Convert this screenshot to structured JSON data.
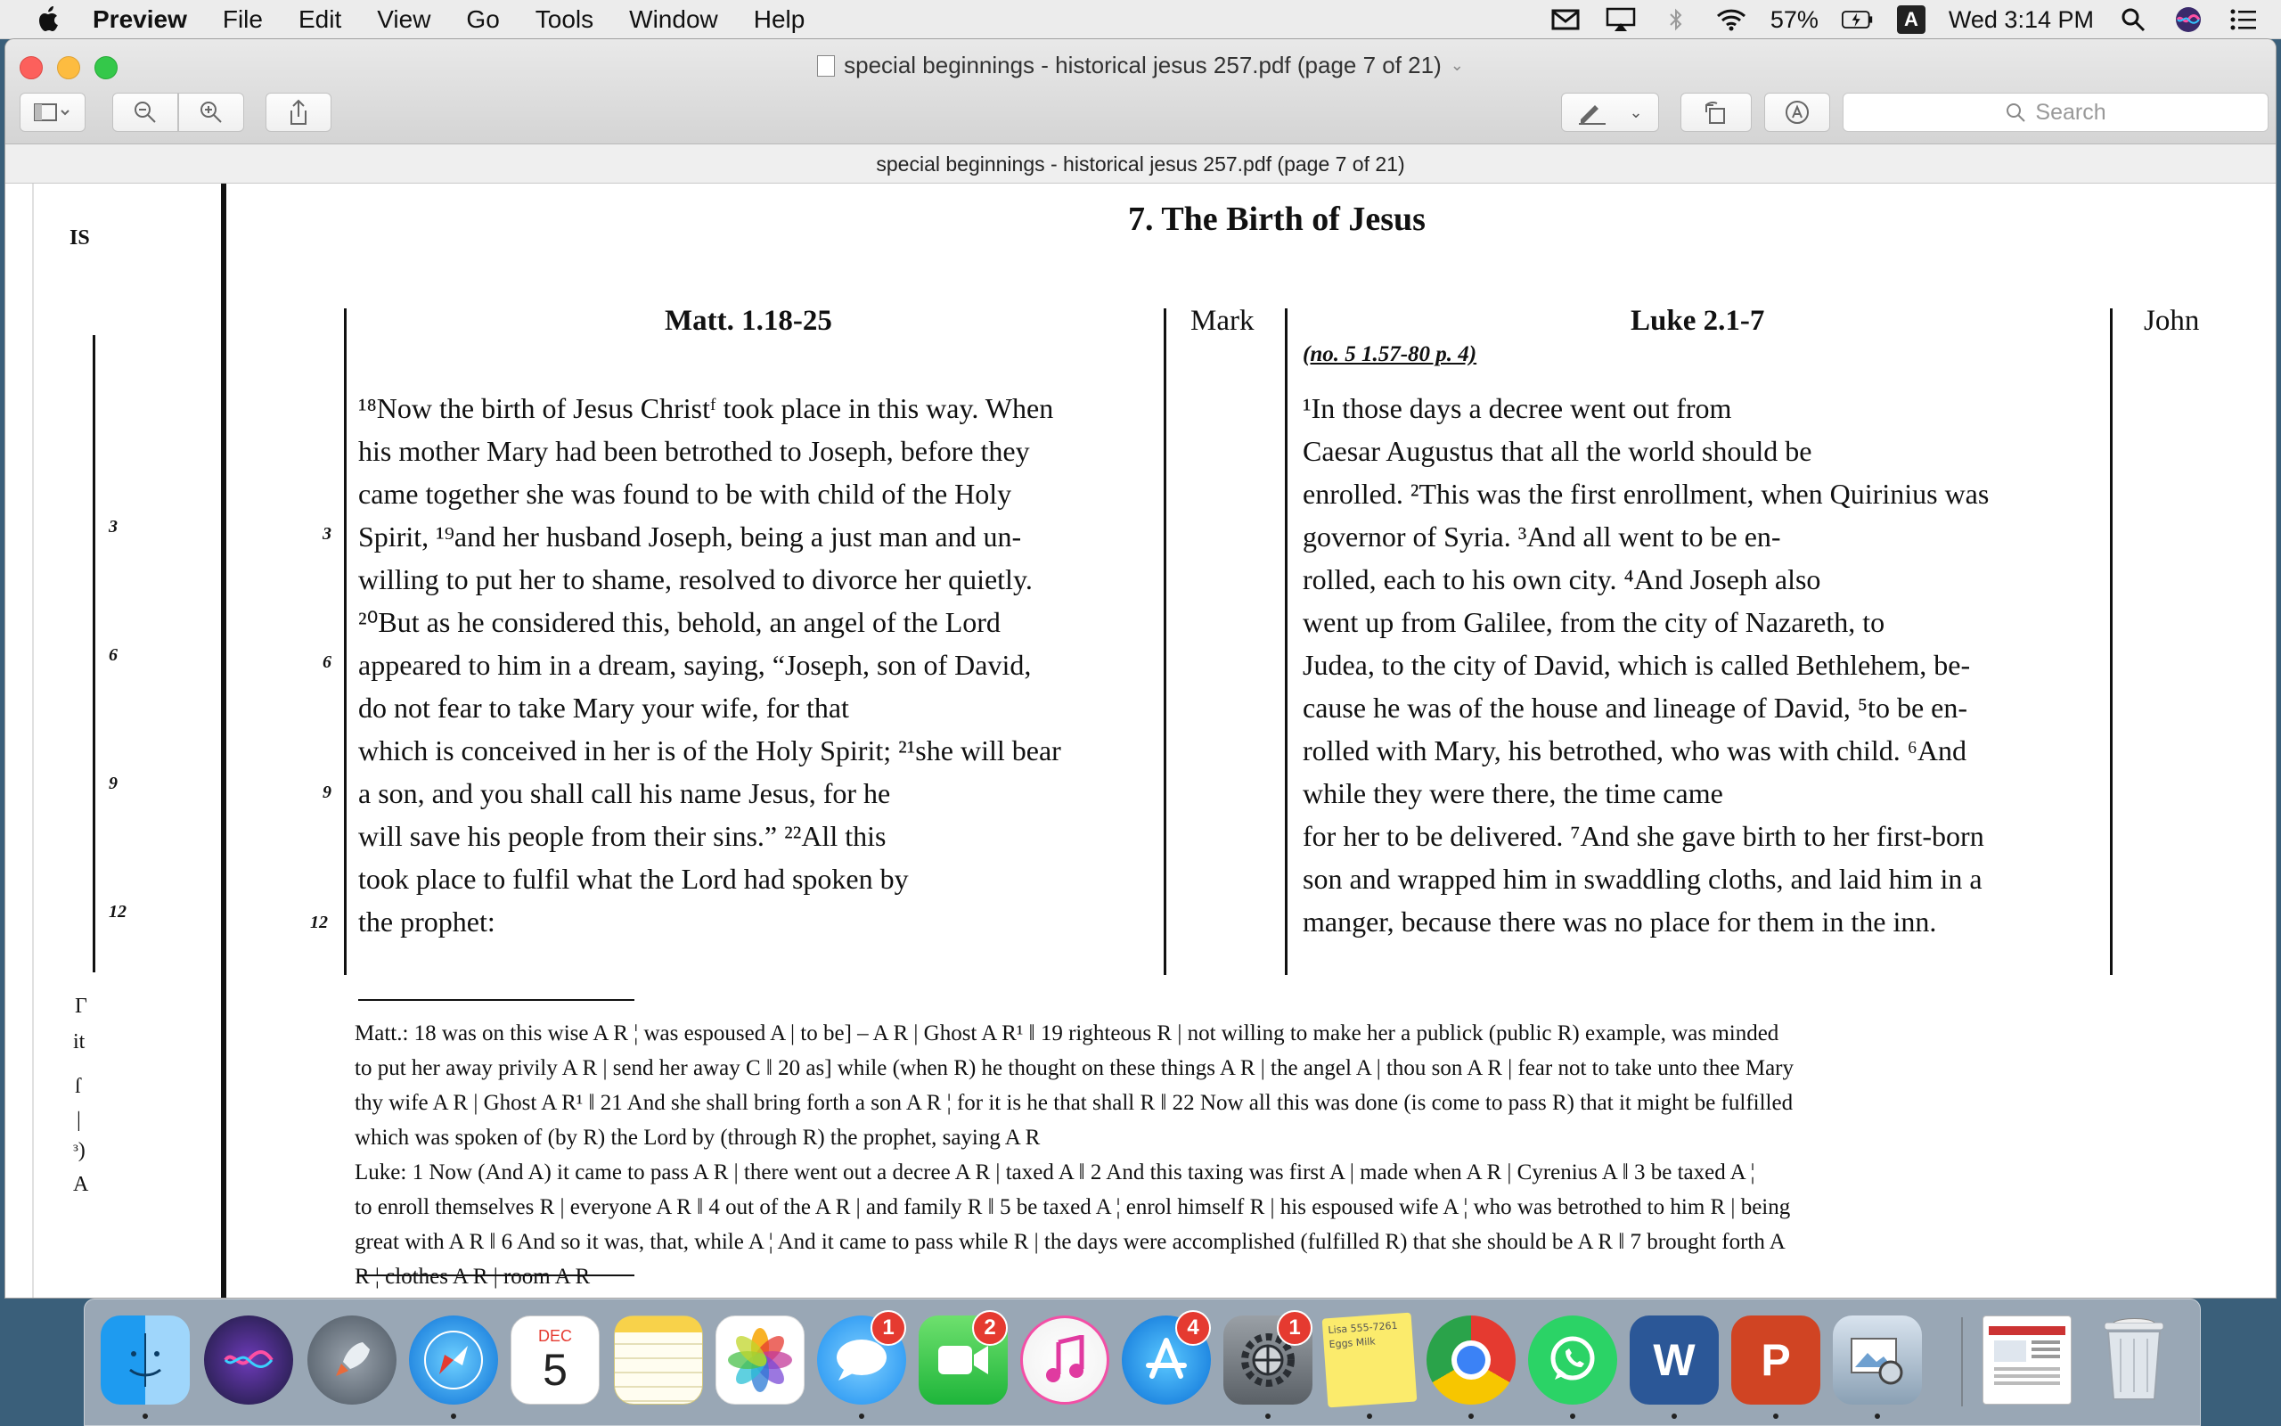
{
  "menubar": {
    "app": "Preview",
    "items": [
      "File",
      "Edit",
      "View",
      "Go",
      "Tools",
      "Window",
      "Help"
    ],
    "battery": "57%",
    "input_source": "A",
    "clock": "Wed 3:14 PM"
  },
  "window": {
    "title": "special beginnings - historical jesus 257.pdf (page 7 of 21)",
    "subtitle": "special beginnings - historical jesus 257.pdf (page 7 of 21)",
    "search_placeholder": "Search"
  },
  "page": {
    "section_title": "7. The Birth of Jesus",
    "left_fragment": "IS",
    "matt": {
      "heading": "Matt. 1.18-25",
      "lines": [
        "¹⁸Now the birth of Jesus Christᶠ took place in this way. When",
        "his mother Mary had been betrothed to Joseph, before they",
        "came together she was found to be with child of the Holy",
        "Spirit, ¹⁹and her husband Joseph, being a just man and un-",
        "willing to put her to shame, resolved to divorce her quietly.",
        "²⁰But as he considered this, behold, an angel of the Lord",
        "appeared to him in a dream, saying, “Joseph, son of David,",
        "do not fear to take Mary your wife, for that",
        "which is conceived in her is of the Holy Spirit; ²¹she will bear",
        "a son, and you shall call his name Jesus, for he",
        "will save his people from their sins.” ²²All this",
        "took place to fulfil what the Lord had spoken by",
        "the prophet:"
      ]
    },
    "mark": {
      "heading": "Mark"
    },
    "luke": {
      "heading": "Luke 2.1-7",
      "crossref": "(no. 5   1.57-80   p. 4)",
      "lines": [
        "¹In those days a decree went out from",
        "Caesar Augustus that all the world should be",
        "enrolled. ²This was the first enrollment, when Quirinius was",
        "governor of Syria. ³And all went to be en-",
        "rolled, each to his own city. ⁴And Joseph also",
        "went up from Galilee, from the city of Nazareth, to",
        "Judea, to the city of David, which is called Bethlehem, be-",
        "cause he was of the house and lineage of David, ⁵to be en-",
        "rolled with Mary, his betrothed, who was with child. ⁶And",
        "while they were there, the time came",
        "for her to be delivered. ⁷And she gave birth to her first-born",
        "son and wrapped him in swaddling cloths, and laid him in a",
        "manger, because there was no place for them in the inn."
      ]
    },
    "john": {
      "heading": "John"
    },
    "margin_numbers": [
      "3",
      "6",
      "9",
      "12"
    ],
    "footnotes": [
      "Matt.: 18 was on this wise A R ¦ was espoused A | to be] – A R | Ghost A R¹ ‖ 19 righteous R | not willing to make her a publick (public R) example, was minded",
      "to put her away privily A R | send her away C ‖ 20 as] while (when R) he thought on these things A R | the angel A | thou son A R | fear not to take unto thee Mary",
      "thy wife A R | Ghost A R¹ ‖ 21 And she shall bring forth a son A R ¦ for it is he that shall R ‖ 22 Now all this was done (is come to pass R) that it might be fulfilled",
      "which was spoken of (by R) the Lord by (through R) the prophet, saying A R",
      "Luke: 1 Now (And A) it came to pass A R | there went out a decree A R | taxed A ‖ 2 And this taxing was first A | made when A R | Cyrenius A ‖ 3 be taxed A ¦",
      "to enroll themselves R | everyone A R ‖ 4 out of the A R | and family R ‖ 5 be taxed A ¦ enrol himself R | his espoused wife A ¦ who was betrothed to him R | being",
      "great with A R ‖ 6 And so it was, that, while A ¦ And it came to pass while R | the days were accomplished (fulfilled R) that she should be A R ‖ 7 brought forth A",
      "R ¦ clothes A R | room A R"
    ],
    "left_fragments": [
      "Γ",
      "it",
      "ſ",
      "|",
      "ᶟ)",
      "A"
    ]
  },
  "dock": {
    "calendar_month": "DEC",
    "calendar_day": "5",
    "badges": {
      "messages": "1",
      "facetime": "2",
      "appstore": "4",
      "sysprefs": "1"
    },
    "stickies_note": "Lisa 555-7261 Eggs Milk"
  },
  "colors": {
    "close": "#fc605c",
    "minimize": "#fdbc40",
    "maximize": "#34c84a",
    "badge": "#e53a30"
  }
}
